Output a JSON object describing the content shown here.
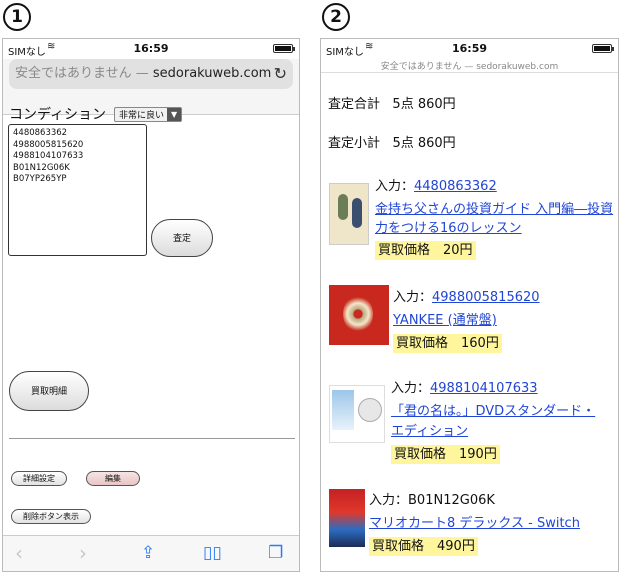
{
  "markers": [
    "1",
    "2"
  ],
  "status": {
    "carrier": "SIMなし",
    "time": "16:59"
  },
  "screen1": {
    "url_prefix": "安全ではありません — ",
    "url_domain": "sedorakuweb.com",
    "condition_label": "コンディション",
    "condition_value": "非常に良い",
    "isbns": [
      "4480863362",
      "4988005815620",
      "4988104107633",
      "B01N12G06K",
      "B07YP265YP"
    ],
    "assess_button": "査定",
    "detail_button": "買取明細",
    "settings_button": "詳細設定",
    "edit_button": "編集",
    "delete_button": "削除ボタン表示"
  },
  "screen2": {
    "url": "安全ではありません — sedorakuweb.com",
    "total_label": "査定合計",
    "total_value": "5点 860円",
    "subtotal_label": "小計",
    "subtotal_value": "5点 860円",
    "input_label": "入力：",
    "items": [
      {
        "code": "4480863362",
        "title_line1": "金持ち父さんの投資ガイド 入門編―投資",
        "title_line2": "力をつける16のレッスン",
        "price": "買取価格　20円"
      },
      {
        "code": "4988005815620",
        "title_line1": "YANKEE (通常盤)",
        "title_line2": "",
        "price": "買取価格　160円"
      },
      {
        "code": "4988104107633",
        "title_line1": "「君の名は。」DVDスタンダード・",
        "title_line2": "エディション",
        "price": "買取価格　190円"
      },
      {
        "code": "B01N12G06K",
        "title_line1": "マリオカート8 デラックス - Switch",
        "title_line2": "",
        "price": "買取価格　490円"
      }
    ]
  }
}
